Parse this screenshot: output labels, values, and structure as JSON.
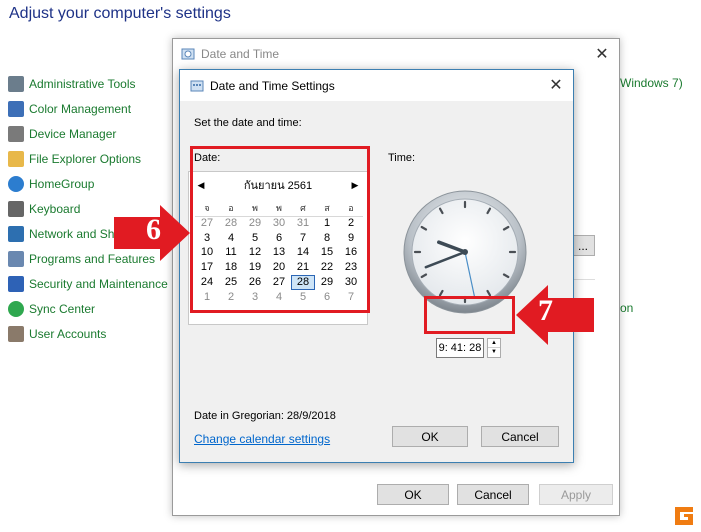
{
  "control_panel": {
    "title": "Adjust your computer's settings",
    "items": [
      {
        "label": "Administrative Tools",
        "icon": "admin-tools-icon"
      },
      {
        "label": "Color Management",
        "icon": "color-management-icon"
      },
      {
        "label": "Device Manager",
        "icon": "device-manager-icon"
      },
      {
        "label": "File Explorer Options",
        "icon": "folder-options-icon"
      },
      {
        "label": "HomeGroup",
        "icon": "homegroup-icon"
      },
      {
        "label": "Keyboard",
        "icon": "keyboard-icon"
      },
      {
        "label": "Network and Sha",
        "icon": "network-icon"
      },
      {
        "label": "Programs and Features",
        "icon": "programs-icon"
      },
      {
        "label": "Security and Maintenance",
        "icon": "flag-icon"
      },
      {
        "label": "Sync Center",
        "icon": "sync-icon"
      },
      {
        "label": "User Accounts",
        "icon": "user-accounts-icon"
      }
    ],
    "right_text_1": "Windows 7)",
    "right_text_2": "on"
  },
  "outer_dialog": {
    "title": "Date and Time",
    "ok_label": "OK",
    "cancel_label": "Cancel",
    "apply_label": "Apply"
  },
  "inner_dialog": {
    "title": "Date and Time Settings",
    "instruction": "Set the date and time:",
    "date_label": "Date:",
    "time_label": "Time:",
    "calendar": {
      "month_label": "กันยายน 2561",
      "days_of_week": [
        "จ",
        "อ",
        "พ",
        "พ",
        "ศ",
        "ส",
        "อ"
      ],
      "weeks": [
        [
          "27",
          "28",
          "29",
          "30",
          "31",
          "1",
          "2"
        ],
        [
          "3",
          "4",
          "5",
          "6",
          "7",
          "8",
          "9"
        ],
        [
          "10",
          "11",
          "12",
          "13",
          "14",
          "15",
          "16"
        ],
        [
          "17",
          "18",
          "19",
          "20",
          "21",
          "22",
          "23"
        ],
        [
          "24",
          "25",
          "26",
          "27",
          "28",
          "29",
          "30"
        ],
        [
          "1",
          "2",
          "3",
          "4",
          "5",
          "6",
          "7"
        ]
      ],
      "selected": "28"
    },
    "time_value": "9: 41: 28",
    "gregorian_text": "Date in Gregorian: 28/9/2018",
    "link_text": "Change calendar settings",
    "ok_label": "OK",
    "cancel_label": "Cancel"
  },
  "annotations": {
    "step_6": "6",
    "step_7": "7",
    "color": "#e11b22"
  },
  "colors": {
    "link_green": "#1a7a2f",
    "title_blue": "#1e3287",
    "accent_blue": "#0066cc"
  }
}
